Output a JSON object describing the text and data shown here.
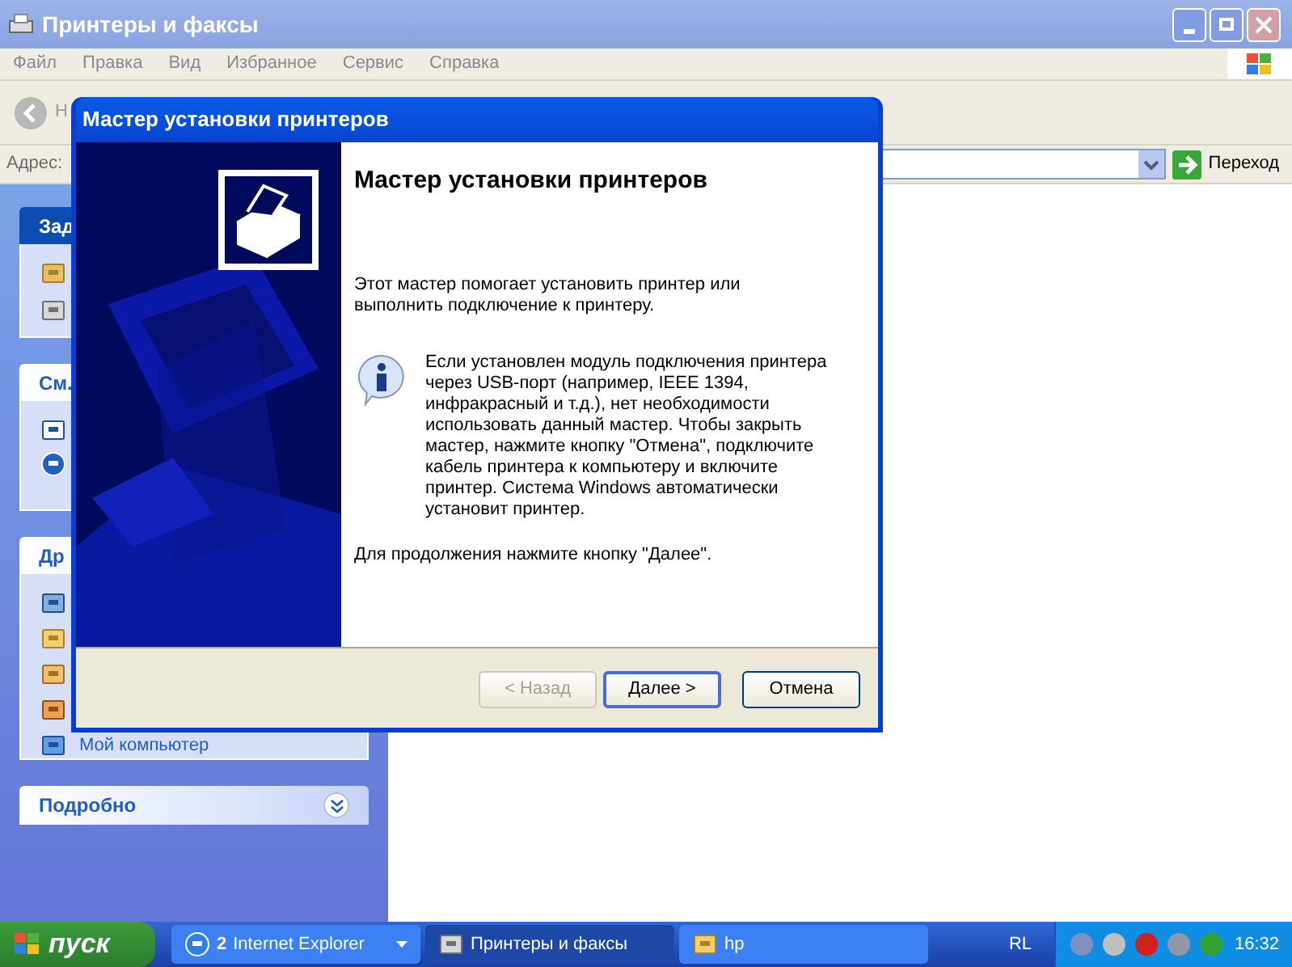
{
  "window": {
    "title": "Принтеры и факсы"
  },
  "menu": [
    "Файл",
    "Правка",
    "Вид",
    "Избранное",
    "Сервис",
    "Справка"
  ],
  "toolbar": {
    "back_label": "Н"
  },
  "address": {
    "label": "Адрес:",
    "go": "Переход"
  },
  "sidebar": [
    {
      "title": "Зад",
      "kind": "task"
    },
    {
      "title": "См.",
      "kind": "task"
    },
    {
      "title": "Др",
      "kind": "task",
      "last_link": "Мой компьютер"
    },
    {
      "title": "Подробно",
      "kind": "collapsed"
    }
  ],
  "dialog": {
    "title": "Мастер установки принтеров",
    "heading": "Мастер установки принтеров",
    "intro": "Этот мастер помогает установить принтер или выполнить подключение к принтеру.",
    "info": "Если установлен модуль подключения принтера через USB-порт (например, IEEE 1394, инфракрасный и т.д.), нет необходимости использовать данный мастер. Чтобы закрыть мастер, нажмите кнопку \"Отмена\", подключите кабель принтера к компьютеру и включите принтер. Система Windows автоматически установит принтер.",
    "footer": "Для продолжения нажмите кнопку \"Далее\".",
    "buttons": [
      {
        "label": "< Назад",
        "disabled": true,
        "default": false
      },
      {
        "label": "Далее >",
        "disabled": false,
        "default": true
      },
      {
        "label": "Отмена",
        "disabled": false,
        "default": false
      }
    ]
  },
  "taskbar": {
    "start": "пуск",
    "tasks": [
      {
        "label": "Internet Explorer",
        "count": "2",
        "selected": false
      },
      {
        "label": "Принтеры и факсы",
        "selected": true
      },
      {
        "label": "hp",
        "selected": false
      }
    ],
    "language": "RL",
    "clock": "16:32"
  }
}
